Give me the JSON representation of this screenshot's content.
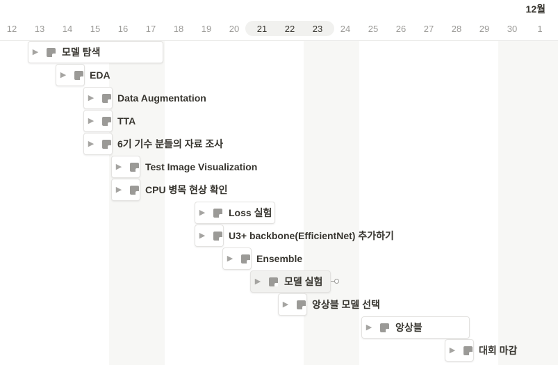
{
  "timeline": {
    "month_label": "12월",
    "days": [
      "12",
      "13",
      "14",
      "15",
      "16",
      "17",
      "18",
      "19",
      "20",
      "21",
      "22",
      "23",
      "24",
      "25",
      "26",
      "27",
      "28",
      "29",
      "30",
      "1"
    ],
    "highlighted_days": [
      "21",
      "22",
      "23"
    ]
  },
  "tasks": [
    {
      "title": "모델 탐색"
    },
    {
      "title": "EDA"
    },
    {
      "title": "Data Augmentation"
    },
    {
      "title": "TTA"
    },
    {
      "title": "6기 기수 분들의 자료 조사"
    },
    {
      "title": "Test Image Visualization"
    },
    {
      "title": "CPU 병목 현상 확인"
    },
    {
      "title": "Loss 실험"
    },
    {
      "title": "U3+ backbone(EfficientNet) 추가하기"
    },
    {
      "title": "Ensemble"
    },
    {
      "title": "모델 실험"
    },
    {
      "title": "앙상블 모델 선택"
    },
    {
      "title": "앙상블"
    },
    {
      "title": "대회 마감"
    }
  ],
  "icons": {
    "toggle": "triangle-right-icon",
    "page": "page-icon"
  },
  "colors": {
    "weekend": "#f7f7f5",
    "text": "#37352f",
    "muted": "#9b9a97"
  }
}
